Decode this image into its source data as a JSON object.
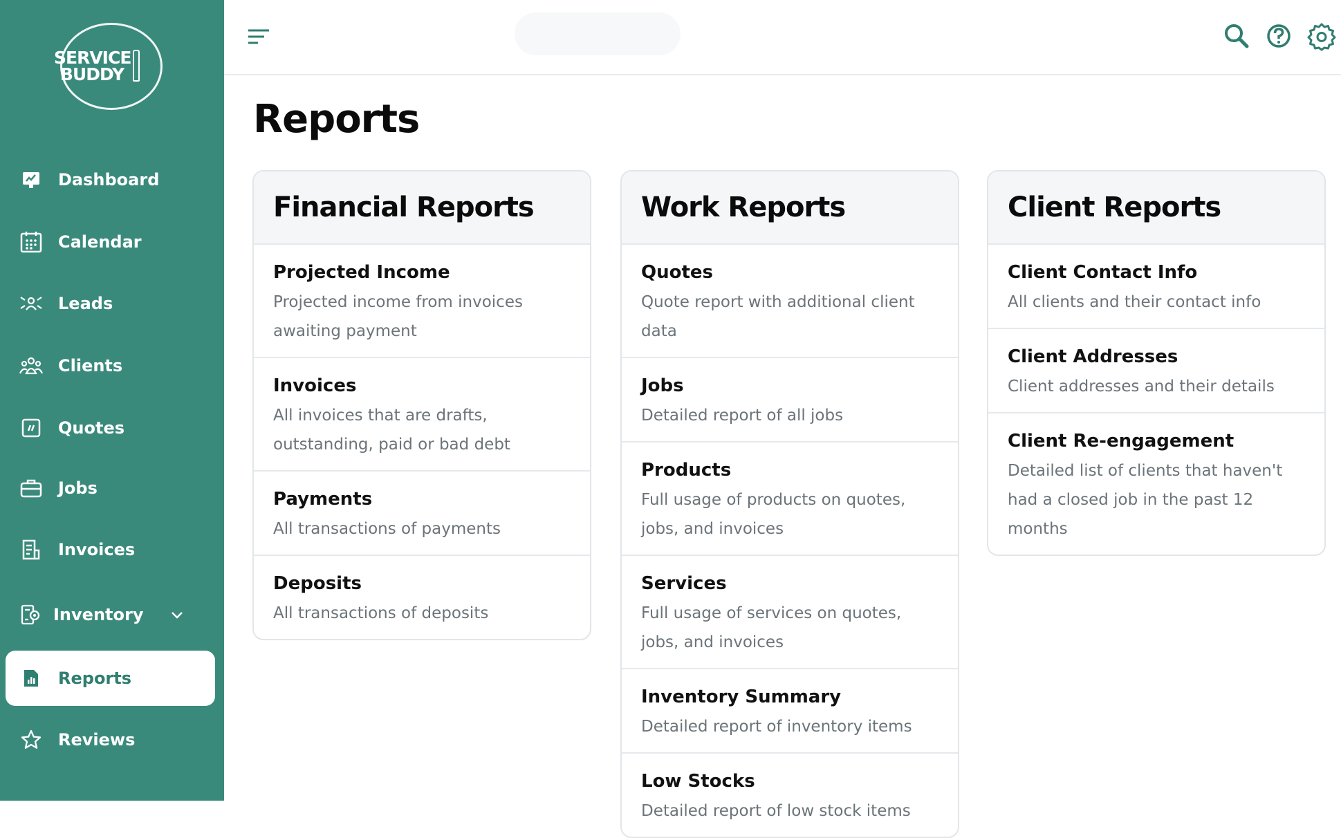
{
  "brand": {
    "line1": "SERVICE",
    "line2": "BUDDY",
    "accent": "#3a8a7c"
  },
  "sidebar": {
    "items": [
      {
        "label": "Dashboard",
        "icon": "dashboard-icon"
      },
      {
        "label": "Calendar",
        "icon": "calendar-icon"
      },
      {
        "label": "Leads",
        "icon": "leads-icon"
      },
      {
        "label": "Clients",
        "icon": "clients-icon"
      },
      {
        "label": "Quotes",
        "icon": "quotes-icon"
      },
      {
        "label": "Jobs",
        "icon": "briefcase-icon"
      },
      {
        "label": "Invoices",
        "icon": "invoice-icon"
      },
      {
        "label": "Inventory",
        "icon": "inventory-icon"
      },
      {
        "label": "Reports",
        "icon": "reports-icon",
        "active": true
      },
      {
        "label": "Reviews",
        "icon": "star-icon"
      }
    ]
  },
  "topbar": {
    "icons": [
      "menu-icon",
      "search-icon",
      "help-icon",
      "settings-icon"
    ]
  },
  "page": {
    "title": "Reports"
  },
  "cards": [
    {
      "title": "Financial Reports",
      "rows": [
        {
          "title": "Projected Income",
          "desc": "Projected income from invoices awaiting payment"
        },
        {
          "title": "Invoices",
          "desc": "All invoices that are drafts, outstanding, paid or bad debt"
        },
        {
          "title": "Payments",
          "desc": "All transactions of payments"
        },
        {
          "title": "Deposits",
          "desc": "All transactions of deposits"
        }
      ]
    },
    {
      "title": "Work Reports",
      "rows": [
        {
          "title": "Quotes",
          "desc": "Quote report with additional client data"
        },
        {
          "title": "Jobs",
          "desc": "Detailed report of all jobs"
        },
        {
          "title": "Products",
          "desc": "Full usage of products on quotes, jobs, and invoices"
        },
        {
          "title": "Services",
          "desc": "Full usage of services on quotes, jobs, and invoices"
        },
        {
          "title": "Inventory Summary",
          "desc": "Detailed report of inventory items"
        },
        {
          "title": "Low Stocks",
          "desc": "Detailed report of low stock items"
        }
      ]
    },
    {
      "title": "Client Reports",
      "rows": [
        {
          "title": "Client Contact Info",
          "desc": "All clients and their contact info"
        },
        {
          "title": "Client Addresses",
          "desc": "Client addresses and their details"
        },
        {
          "title": "Client Re-engagement",
          "desc": "Detailed list of clients that haven't had a closed job in the past 12 months"
        }
      ]
    }
  ]
}
